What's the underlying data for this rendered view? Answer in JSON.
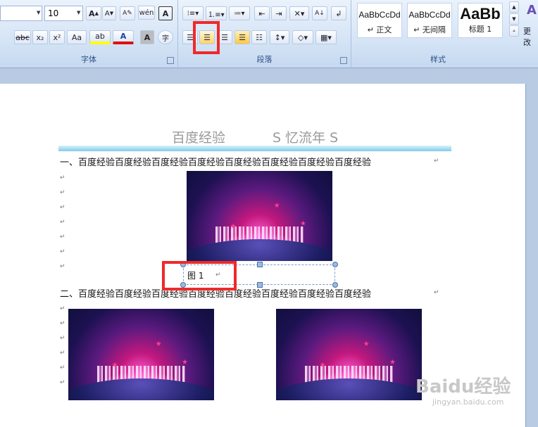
{
  "ribbon": {
    "font_group": {
      "label": "字体",
      "font_size": "10",
      "bold_letter": "A",
      "strike_label": "abc",
      "sub_label": "x₂",
      "sup_label": "x²",
      "case_label": "Aa",
      "highlight_label": "ab",
      "color_label": "A",
      "char_shade_label": "A",
      "enclose_label": "字"
    },
    "paragraph_group": {
      "label": "段落"
    },
    "styles_group": {
      "label": "样式",
      "styles": [
        {
          "sample": "AaBbCcDd",
          "name": "↵ 正文"
        },
        {
          "sample": "AaBbCcDd",
          "name": "↵ 无间隔"
        },
        {
          "sample": "AaBb",
          "name": "标题 1"
        }
      ],
      "change_label": "更改"
    }
  },
  "document": {
    "header_left": "百度经验",
    "header_right": "S 忆流年 S",
    "para1": "一、百度经验百度经验百度经验百度经验百度经验百度经验百度经验百度经验",
    "caption": "图 1",
    "para2": "二、百度经验百度经验百度经验百度经验百度经验百度经验百度经验百度经验",
    "return_mark": "↵"
  },
  "watermark": {
    "brand": "Baidu经验",
    "url": "jingyan.baidu.com"
  },
  "colors": {
    "highlight": "#ee2a2a",
    "header_text": "#9a9a9a",
    "rule": "#8fd2ee"
  }
}
